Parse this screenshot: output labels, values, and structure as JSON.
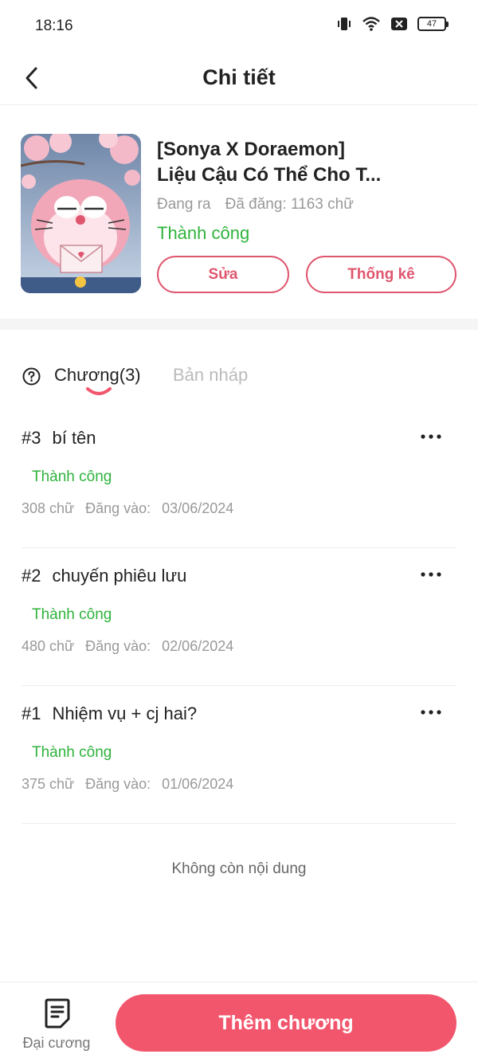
{
  "status_bar": {
    "time": "18:16",
    "battery": "47"
  },
  "nav": {
    "title": "Chi tiết"
  },
  "book": {
    "title_line1": "[Sonya X Doraemon]",
    "title_line2": "Liệu Cậu Có Thể Cho T...",
    "state": "Đang ra",
    "word_count": "Đã đăng: 1163 chữ",
    "status": "Thành  công",
    "edit_label": "Sửa",
    "stats_label": "Thống kê"
  },
  "tabs": {
    "chapters": "Chương(3)",
    "drafts": "Bản nháp"
  },
  "chapters": [
    {
      "number": "#3",
      "title": "bí tên",
      "status": "Thành công",
      "words": "308 chữ",
      "posted_label": "Đăng vào:",
      "date": "03/06/2024"
    },
    {
      "number": "#2",
      "title": "chuyến phiêu lưu",
      "status": "Thành công",
      "words": "480 chữ",
      "posted_label": "Đăng vào:",
      "date": "02/06/2024"
    },
    {
      "number": "#1",
      "title": "Nhiệm vụ + cj hai?",
      "status": "Thành công",
      "words": "375 chữ",
      "posted_label": "Đăng vào:",
      "date": "01/06/2024"
    }
  ],
  "end_note": "Không còn nội dung",
  "bottom": {
    "outline_label": "Đại cương",
    "add_chapter_label": "Thêm chương"
  },
  "icons": {
    "back": "chevron-left-icon",
    "help": "question-circle-icon",
    "more": "more-horizontal-icon",
    "outline": "document-list-icon"
  },
  "colors": {
    "accent": "#f2566d",
    "accent_border": "#e0566e",
    "success": "#2fb33c",
    "muted": "#999999"
  }
}
